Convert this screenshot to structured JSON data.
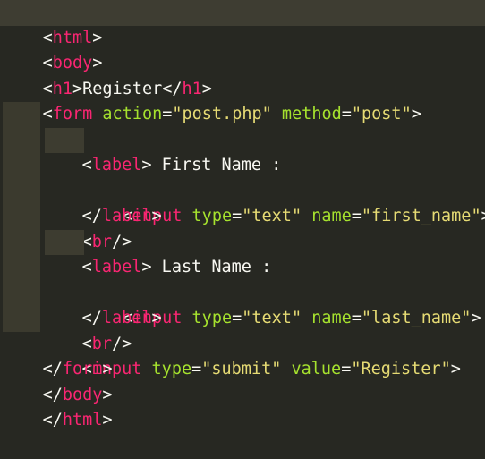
{
  "editor": {
    "colors": {
      "background": "#272822",
      "tag": "#f92672",
      "attribute": "#a6e22e",
      "string": "#e6db74",
      "text": "#f8f8f2",
      "current_line": "#3e3d32",
      "indent_guide": "#3b3a2e"
    },
    "lines": [
      {
        "tokens": [
          "<",
          "html",
          ">"
        ]
      },
      {
        "tokens": [
          "<",
          "body",
          ">"
        ]
      },
      {
        "tokens": [
          "<",
          "h1",
          ">",
          "Register",
          "</",
          "h1",
          ">"
        ]
      },
      {
        "tokens": [
          "<",
          "form",
          " ",
          "action",
          "=",
          "\"post.php\"",
          " ",
          "method",
          "=",
          "\"post\"",
          ">"
        ]
      },
      {
        "tokens": [
          "<",
          "label",
          ">",
          " First Name :"
        ]
      },
      {
        "tokens": [
          "<",
          "input",
          " ",
          "type",
          "=",
          "\"text\"",
          " ",
          "name",
          "=",
          "\"first_name\"",
          ">"
        ]
      },
      {
        "tokens": [
          "</",
          "label",
          ">"
        ]
      },
      {
        "tokens": [
          "<",
          "br",
          "/>"
        ]
      },
      {
        "tokens": [
          "<",
          "label",
          ">",
          " Last Name :"
        ]
      },
      {
        "tokens": [
          "<",
          "input",
          " ",
          "type",
          "=",
          "\"text\"",
          " ",
          "name",
          "=",
          "\"last_name\"",
          ">"
        ]
      },
      {
        "tokens": [
          "</",
          "label",
          ">"
        ]
      },
      {
        "tokens": [
          "<",
          "br",
          "/>"
        ]
      },
      {
        "tokens": [
          "<",
          "input",
          " ",
          "type",
          "=",
          "\"submit\"",
          " ",
          "value",
          "=",
          "\"Register\"",
          ">"
        ]
      },
      {
        "tokens": [
          "</",
          "form",
          ">"
        ]
      },
      {
        "tokens": [
          "</",
          "body",
          ">"
        ]
      },
      {
        "tokens": [
          "</",
          "html",
          ">"
        ]
      }
    ]
  }
}
